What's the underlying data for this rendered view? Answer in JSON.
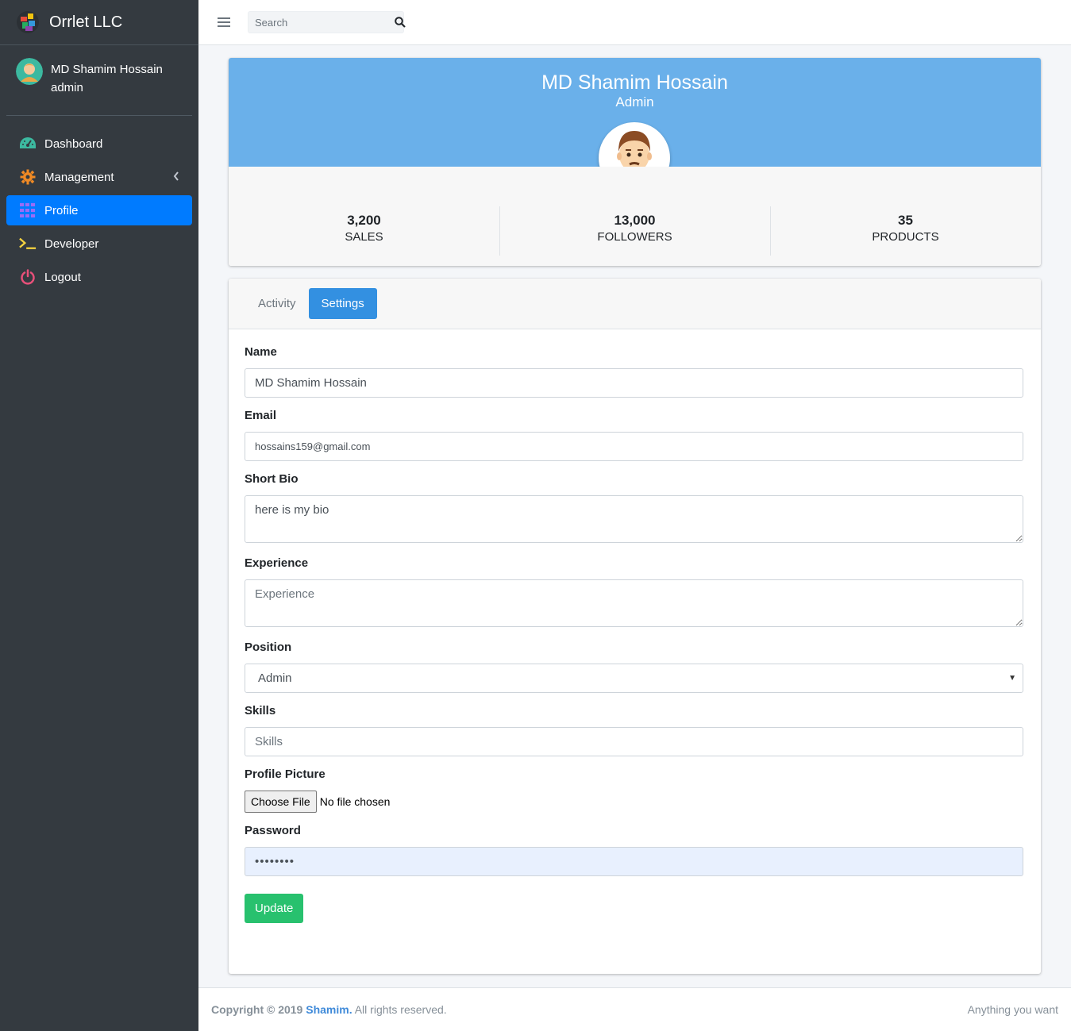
{
  "brand": {
    "name": "Orrlet LLC"
  },
  "user": {
    "name": "MD Shamim Hossain",
    "role": "admin"
  },
  "sidebar": {
    "items": [
      {
        "label": "Dashboard",
        "icon": "tachometer-icon"
      },
      {
        "label": "Management",
        "icon": "gear-icon"
      },
      {
        "label": "Profile",
        "icon": "grid-icon",
        "active": true
      },
      {
        "label": "Developer",
        "icon": "terminal-icon"
      },
      {
        "label": "Logout",
        "icon": "power-icon"
      }
    ]
  },
  "topbar": {
    "search_placeholder": "Search"
  },
  "profile": {
    "name": "MD Shamim Hossain",
    "role": "Admin",
    "stats": [
      {
        "value": "3,200",
        "label": "SALES"
      },
      {
        "value": "13,000",
        "label": "FOLLOWERS"
      },
      {
        "value": "35",
        "label": "PRODUCTS"
      }
    ]
  },
  "tabs": {
    "activity": "Activity",
    "settings": "Settings"
  },
  "form": {
    "name_label": "Name",
    "name_value": "MD Shamim Hossain",
    "email_label": "Email",
    "email_value": "hossains159@gmail.com",
    "bio_label": "Short Bio",
    "bio_value": "here is my bio",
    "experience_label": "Experience",
    "experience_placeholder": "Experience",
    "position_label": "Position",
    "position_value": "Admin",
    "skills_label": "Skills",
    "skills_placeholder": "Skills",
    "picture_label": "Profile Picture",
    "choose_file": "Choose File",
    "file_status": "No file chosen",
    "password_label": "Password",
    "password_value": "••••••••",
    "update_label": "Update"
  },
  "footer": {
    "copyright": "Copyright © 2019",
    "company": "Shamim.",
    "rights": "All rights reserved.",
    "right_text": "Anything you want"
  },
  "colors": {
    "sidebar": "#343a40",
    "active": "#007bff",
    "profile_header": "#6ab0ea",
    "tab_active": "#3390e1",
    "update_button": "#28c16e"
  }
}
